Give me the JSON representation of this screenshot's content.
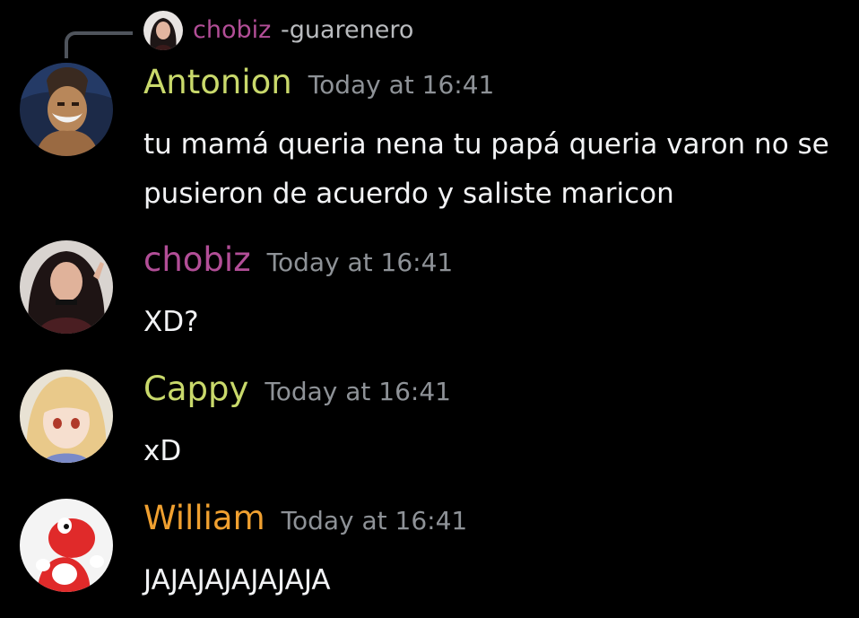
{
  "reply": {
    "author": "chobiz",
    "text": "-guarenero"
  },
  "messages": [
    {
      "author": "Antonion",
      "author_color": "#c9d96b",
      "timestamp": "Today at 16:41",
      "lines": [
        "tu mamá queria nena tu papá queria varon no se",
        "pusieron de acuerdo y saliste maricon"
      ]
    },
    {
      "author": "chobiz",
      "author_color": "#b24e97",
      "timestamp": "Today at 16:41",
      "lines": [
        "XD?"
      ]
    },
    {
      "author": "Cappy",
      "author_color": "#c9d96b",
      "timestamp": "Today at 16:41",
      "lines": [
        "xD"
      ]
    },
    {
      "author": "William",
      "author_color": "#f0a030",
      "timestamp": "Today at 16:41",
      "lines": [
        "JAJAJAJAJAJAJA"
      ]
    }
  ]
}
